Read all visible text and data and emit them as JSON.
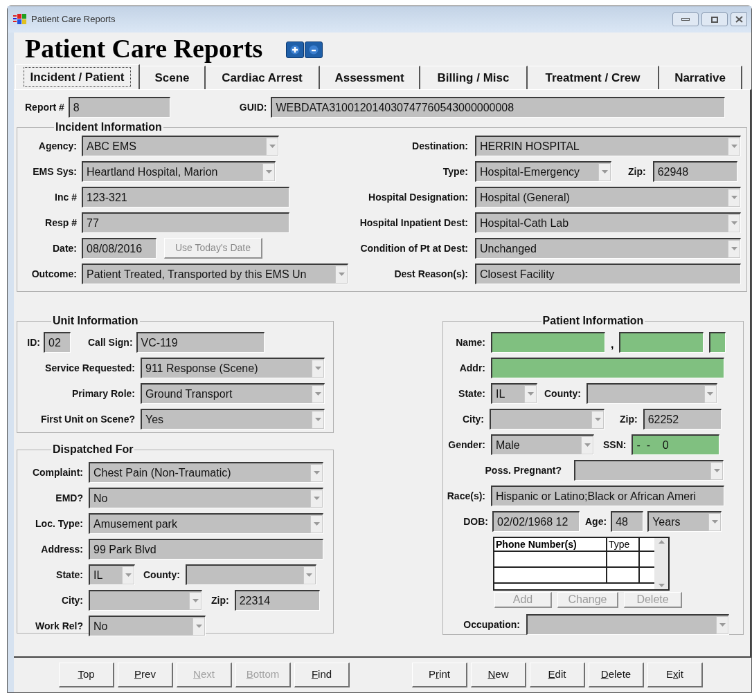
{
  "window": {
    "title": "Patient Care Reports"
  },
  "header": {
    "title": "Patient Care Reports"
  },
  "tabs": [
    {
      "label": "Incident / Patient",
      "selected": true
    },
    {
      "label": "Scene",
      "selected": false
    },
    {
      "label": "Cardiac Arrest",
      "selected": false
    },
    {
      "label": "Assessment",
      "selected": false
    },
    {
      "label": "Billing / Misc",
      "selected": false
    },
    {
      "label": "Treatment / Crew",
      "selected": false
    },
    {
      "label": "Narrative",
      "selected": false
    }
  ],
  "report": {
    "label": "Report #",
    "value": "8"
  },
  "guid": {
    "label": "GUID:",
    "value": "WEBDATA310012014030747760543000000008"
  },
  "incident_information": {
    "title": "Incident Information",
    "left": [
      {
        "label": "Agency:",
        "kind": "combo",
        "value": "ABC EMS"
      },
      {
        "label": "EMS Sys:",
        "kind": "combo",
        "value": "Heartland Hospital, Marion"
      },
      {
        "label": "Inc #",
        "kind": "text",
        "value": "123-321"
      },
      {
        "label": "Resp #",
        "kind": "text",
        "value": "77"
      },
      {
        "label": "Date:",
        "kind": "text",
        "value": "08/08/2016",
        "button": {
          "label": "Use Today's Date",
          "disabled": true
        }
      },
      {
        "label": "Outcome:",
        "kind": "combo",
        "value": "Patient Treated, Transported by this EMS Un"
      }
    ],
    "right": [
      {
        "label": "Destination:",
        "kind": "combo",
        "value": "HERRIN HOSPITAL"
      },
      {
        "label": "Type:",
        "kind": "combo",
        "value": "Hospital-Emergency",
        "zip": {
          "label": "Zip:",
          "value": "62948"
        }
      },
      {
        "label": "Hospital Designation:",
        "kind": "combo",
        "value": "Hospital (General)"
      },
      {
        "label": "Hospital Inpatient Dest:",
        "kind": "combo",
        "value": "Hospital-Cath Lab"
      },
      {
        "label": "Condition of Pt at Dest:",
        "kind": "combo",
        "value": "Unchanged"
      },
      {
        "label": "Dest Reason(s):",
        "kind": "text",
        "value": "Closest Facility"
      }
    ]
  },
  "unit_information": {
    "title": "Unit Information",
    "id": {
      "label": "ID:",
      "value": "02"
    },
    "call_sign": {
      "label": "Call Sign:",
      "value": "VC-119"
    },
    "rows": [
      {
        "label": "Service Requested:",
        "kind": "combo",
        "value": "911 Response (Scene)"
      },
      {
        "label": "Primary Role:",
        "kind": "combo",
        "value": "Ground Transport"
      },
      {
        "label": "First Unit on Scene?",
        "kind": "combo",
        "value": "Yes"
      }
    ]
  },
  "dispatched_for": {
    "title": "Dispatched For",
    "complaint": {
      "label": "Complaint:",
      "value": "Chest Pain (Non-Traumatic)"
    },
    "emd": {
      "label": "EMD?",
      "value": "No"
    },
    "loc_type": {
      "label": "Loc. Type:",
      "value": "Amusement park"
    },
    "address": {
      "label": "Address:",
      "value": "99 Park Blvd"
    },
    "state": {
      "label": "State:",
      "value": "IL"
    },
    "county": {
      "label": "County:"
    },
    "city": {
      "label": "City:"
    },
    "zip": {
      "label": "Zip:",
      "value": "22314"
    },
    "work_rel": {
      "label": "Work Rel?",
      "value": "No"
    }
  },
  "patient_information": {
    "title": "Patient Information",
    "name": {
      "label": "Name:",
      "separator": ",",
      "required": true
    },
    "addr": {
      "label": "Addr:",
      "required": true
    },
    "state": {
      "label": "State:",
      "value": "IL"
    },
    "county": {
      "label": "County:"
    },
    "city": {
      "label": "City:"
    },
    "zip": {
      "label": "Zip:",
      "value": "62252"
    },
    "gender": {
      "label": "Gender:",
      "value": "Male"
    },
    "ssn": {
      "label": "SSN:",
      "value": "-  -    0",
      "required": true
    },
    "poss_pregnant": {
      "label": "Poss. Pregnant?"
    },
    "races": {
      "label": "Race(s):",
      "value": "Hispanic or Latino;Black or African Ameri"
    },
    "dob": {
      "label": "DOB:",
      "value": "02/02/1968 12"
    },
    "age": {
      "label": "Age:",
      "value": "48",
      "unit": "Years"
    },
    "phones": {
      "columns": [
        "Phone Number(s)",
        "Type"
      ]
    },
    "phone_buttons": [
      {
        "label": "Add",
        "disabled": true
      },
      {
        "label": "Change",
        "disabled": true
      },
      {
        "label": "Delete",
        "disabled": true
      }
    ],
    "occupation": {
      "label": "Occupation:"
    }
  },
  "nav_buttons": [
    {
      "key": "T",
      "after": "op",
      "disabled": false
    },
    {
      "key": "P",
      "after": "rev",
      "disabled": false
    },
    {
      "key": "N",
      "after": "ext",
      "disabled": true
    },
    {
      "key": "B",
      "after": "ottom",
      "disabled": true
    },
    {
      "key": "F",
      "after": "ind",
      "disabled": false
    }
  ],
  "action_buttons": [
    {
      "before": "P",
      "key": "r",
      "after": "int",
      "disabled": false
    },
    {
      "key": "N",
      "after": "ew",
      "disabled": false
    },
    {
      "key": "E",
      "after": "dit",
      "disabled": false
    },
    {
      "key": "D",
      "after": "elete",
      "disabled": false
    },
    {
      "before": "E",
      "key": "x",
      "after": "it",
      "disabled": false
    }
  ]
}
